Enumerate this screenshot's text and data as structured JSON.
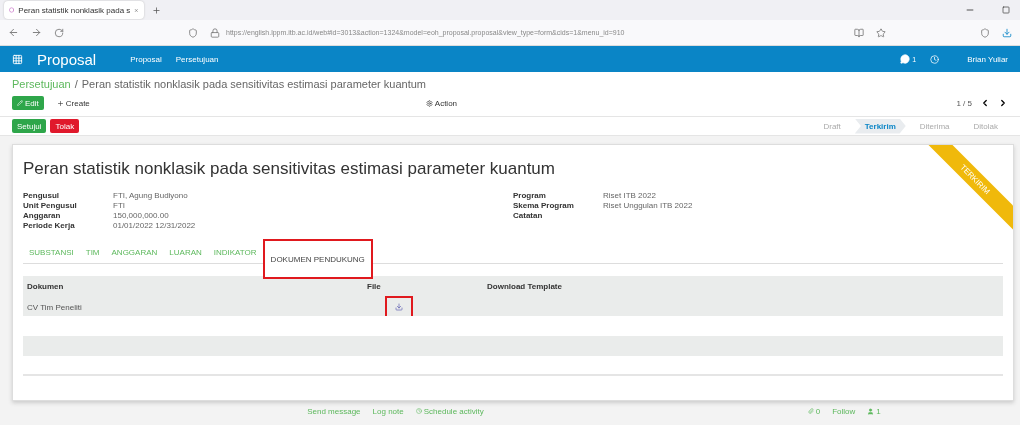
{
  "browser": {
    "tab_title": "Peran statistik nonklasik pada s",
    "url": "https://english.lppm.itb.ac.id/web#id=3013&action=1324&model=eoh_proposal.proposal&view_type=form&cids=1&menu_id=910"
  },
  "navbar": {
    "app": "Proposal",
    "menu": [
      "Proposal",
      "Persetujuan"
    ],
    "chat_count": "1",
    "user": "Brian Yuliar"
  },
  "breadcrumb": {
    "parent": "Persetujuan",
    "separator": "/",
    "current": "Peran statistik nonklasik pada sensitivitas estimasi parameter kuantum"
  },
  "actions": {
    "edit": "Edit",
    "create": "Create",
    "action": "Action",
    "pager": "1 / 5"
  },
  "buttons": [
    {
      "label": "Setujui",
      "kind": "approve"
    },
    {
      "label": "Tolak",
      "kind": "reject"
    }
  ],
  "statuses": [
    {
      "label": "Draft",
      "selected": false
    },
    {
      "label": "Terkirim",
      "selected": true
    },
    {
      "label": "Diterima",
      "selected": false
    },
    {
      "label": "Ditolak",
      "selected": false
    }
  ],
  "record": {
    "title": "Peran statistik nonklasik pada sensitivitas estimasi parameter kuantum",
    "ribbon": "TERKIRIM",
    "left_fields": [
      {
        "label": "Pengusul",
        "value": "FTI, Agung Budiyono"
      },
      {
        "label": "Unit Pengusul",
        "value": "FTI"
      },
      {
        "label": "Anggaran",
        "value": "150,000,000.00"
      },
      {
        "label": "Periode Kerja",
        "value": "01/01/2022 12/31/2022"
      }
    ],
    "right_fields": [
      {
        "label": "Program",
        "value": "Riset ITB 2022"
      },
      {
        "label": "Skema Program",
        "value": "Riset Unggulan ITB 2022"
      },
      {
        "label": "Catatan"
      }
    ]
  },
  "notebook": [
    {
      "label": "SUBSTANSI",
      "selected": false,
      "highlighted": false
    },
    {
      "label": "TIM",
      "selected": false,
      "highlighted": false
    },
    {
      "label": "ANGGARAN",
      "selected": false,
      "highlighted": false
    },
    {
      "label": "LUARAN",
      "selected": false,
      "highlighted": false
    },
    {
      "label": "INDIKATOR",
      "selected": false,
      "highlighted": false
    },
    {
      "label": "DOKUMEN PENDUKUNG",
      "selected": true,
      "highlighted": true
    }
  ],
  "table": {
    "columns": [
      "Dokumen",
      "File",
      "Download Template"
    ],
    "rows": [
      {
        "dokumen": "CV Tim Peneliti",
        "has_file": true,
        "file_highlighted": true
      }
    ]
  },
  "chatter": {
    "left": [
      "Send message",
      "Log note",
      "Schedule activity"
    ],
    "attachments": "0",
    "follow": "Follow",
    "followers": "1"
  }
}
